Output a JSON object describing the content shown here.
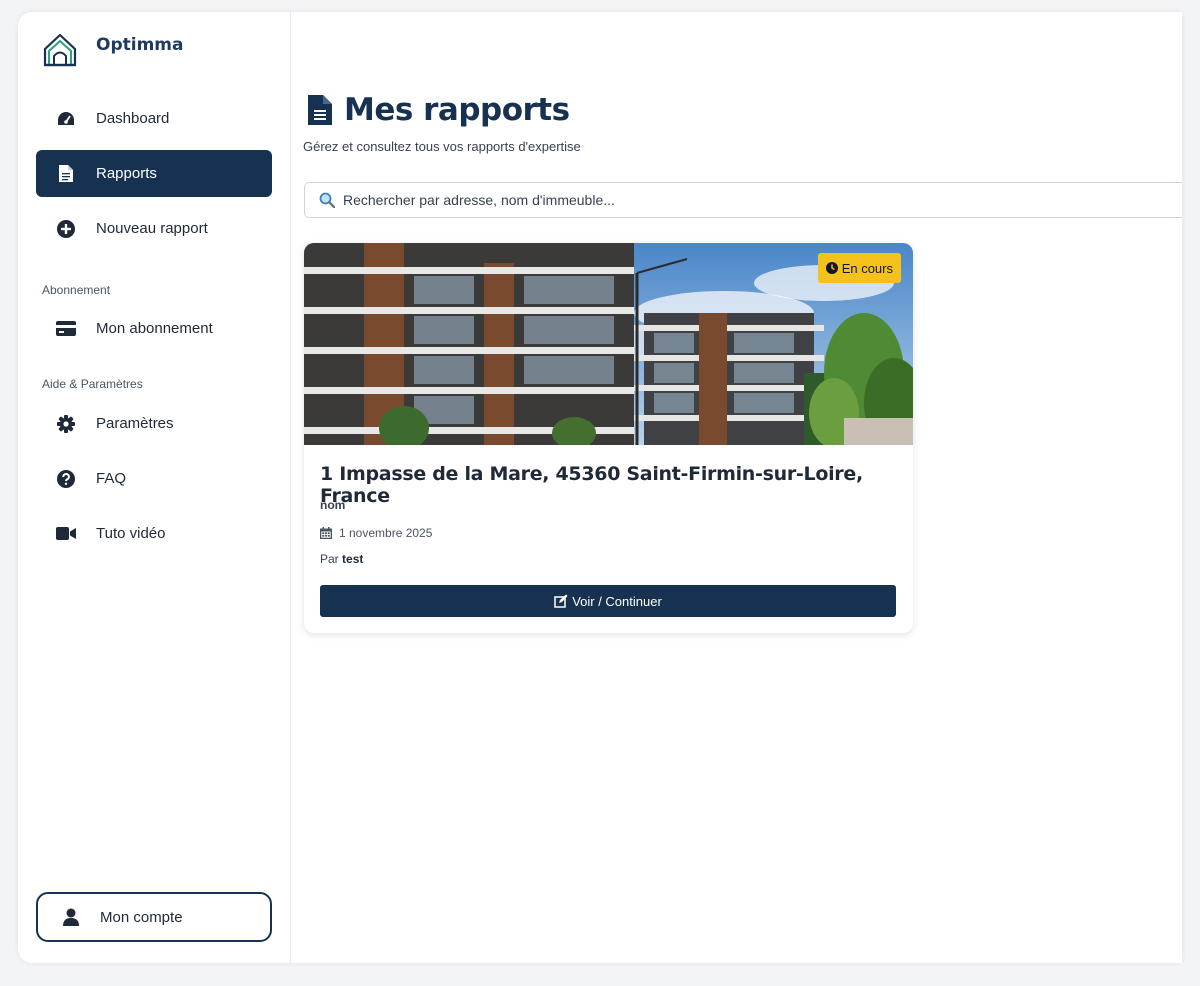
{
  "brand": {
    "name": "Optimma"
  },
  "sidebar": {
    "items": [
      {
        "label": "Dashboard",
        "icon": "tachometer-icon"
      },
      {
        "label": "Rapports",
        "icon": "file-icon",
        "active": true
      },
      {
        "label": "Nouveau rapport",
        "icon": "plus-circle-icon"
      }
    ],
    "section_subscription": "Abonnement",
    "subscription_item": {
      "label": "Mon abonnement",
      "icon": "credit-card-icon"
    },
    "section_help": "Aide & Paramètres",
    "help_items": [
      {
        "label": "Paramètres",
        "icon": "gear-icon"
      },
      {
        "label": "FAQ",
        "icon": "question-circle-icon"
      },
      {
        "label": "Tuto vidéo",
        "icon": "video-icon"
      }
    ],
    "account": {
      "label": "Mon compte",
      "icon": "user-icon"
    }
  },
  "page": {
    "title": "Mes rapports",
    "subtitle": "Gérez et consultez tous vos rapports d'expertise"
  },
  "search": {
    "placeholder": "Rechercher par adresse, nom d'immeuble..."
  },
  "reports": [
    {
      "status": "En cours",
      "address": "1 Impasse de la Mare, 45360 Saint-Firmin-sur-Loire, France",
      "name": "nom",
      "date": "1 novembre 2025",
      "author_prefix": "Par",
      "author": "test",
      "action": "Voir / Continuer"
    }
  ],
  "colors": {
    "primary": "#163250",
    "badge": "#f4c21b",
    "brand_text": "#1d3a5f"
  }
}
